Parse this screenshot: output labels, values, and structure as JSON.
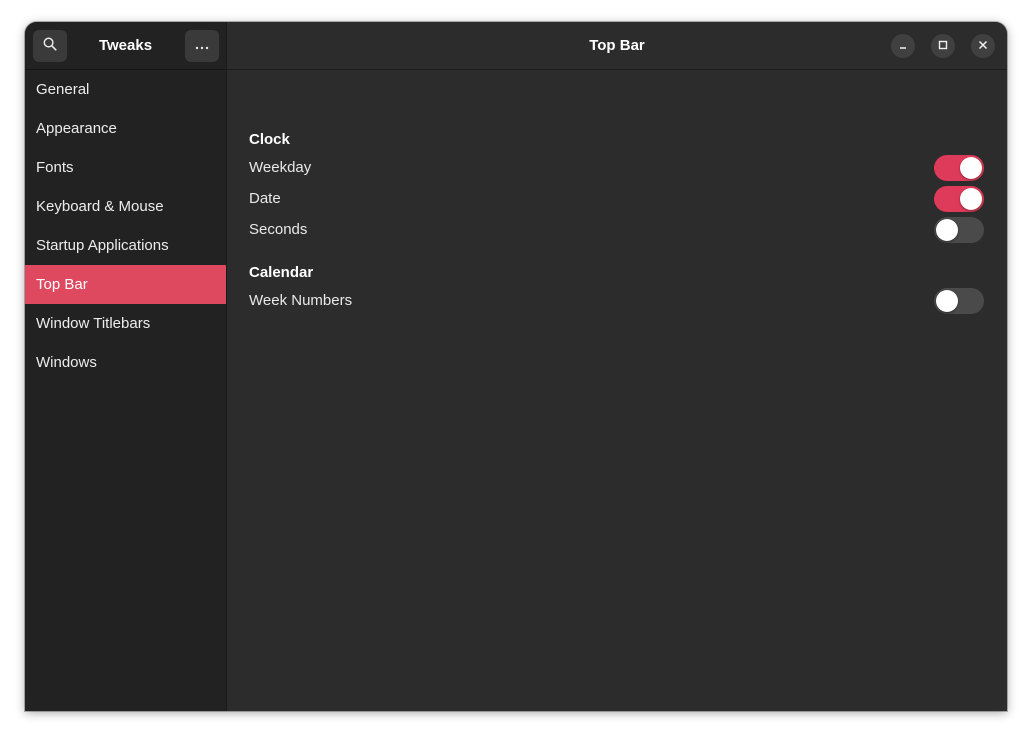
{
  "sidebar": {
    "title": "Tweaks",
    "search_icon": "search-icon",
    "menu_icon": "more-horizontal-icon",
    "items": [
      {
        "label": "General",
        "active": false
      },
      {
        "label": "Appearance",
        "active": false
      },
      {
        "label": "Fonts",
        "active": false
      },
      {
        "label": "Keyboard & Mouse",
        "active": false
      },
      {
        "label": "Startup Applications",
        "active": false
      },
      {
        "label": "Top Bar",
        "active": true
      },
      {
        "label": "Window Titlebars",
        "active": false
      },
      {
        "label": "Windows",
        "active": false
      }
    ]
  },
  "header": {
    "title": "Top Bar",
    "window_controls": [
      "minimize-icon",
      "maximize-icon",
      "close-icon"
    ]
  },
  "sections": {
    "clock": {
      "title": "Clock",
      "rows": [
        {
          "label": "Weekday",
          "enabled": true
        },
        {
          "label": "Date",
          "enabled": true
        },
        {
          "label": "Seconds",
          "enabled": false
        }
      ]
    },
    "calendar": {
      "title": "Calendar",
      "rows": [
        {
          "label": "Week Numbers",
          "enabled": false
        }
      ]
    }
  },
  "colors": {
    "accent": "#de4960",
    "switch_on": "#de3a59",
    "switch_off": "#4a4a4a",
    "sidebar_bg": "#222222",
    "content_bg": "#2c2c2c"
  }
}
